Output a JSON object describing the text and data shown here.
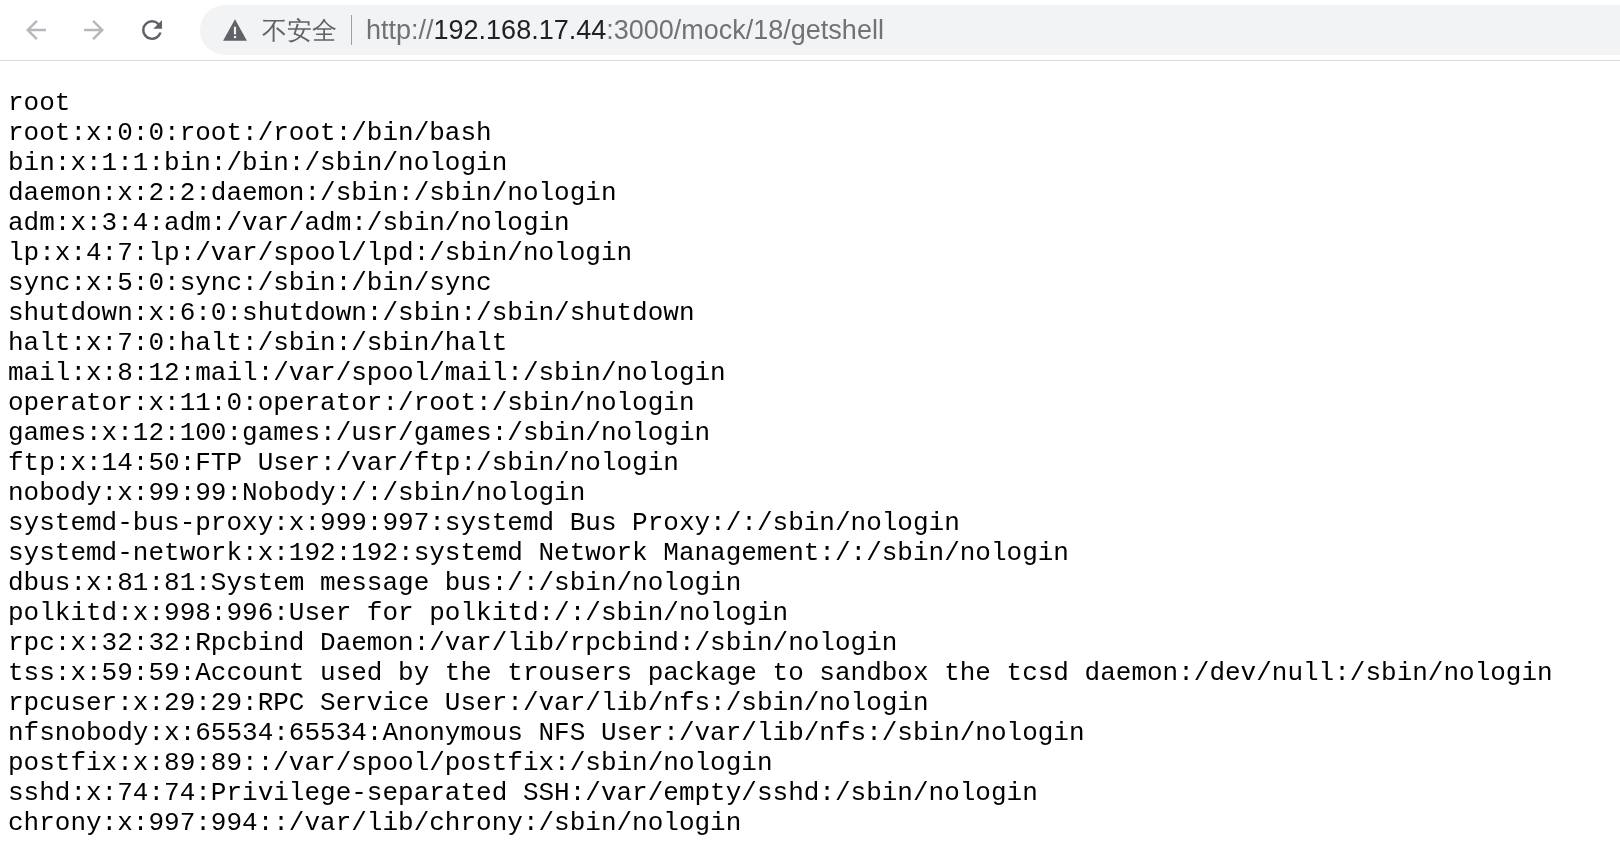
{
  "toolbar": {
    "back": {
      "disabled": true
    },
    "forward": {
      "disabled": true
    },
    "reload": {
      "disabled": false
    },
    "security_label": "不安全",
    "url": {
      "scheme": "http://",
      "host": "192.168.17.44",
      "path": ":3000/mock/18/getshell"
    }
  },
  "lines": [
    "root",
    "root:x:0:0:root:/root:/bin/bash",
    "bin:x:1:1:bin:/bin:/sbin/nologin",
    "daemon:x:2:2:daemon:/sbin:/sbin/nologin",
    "adm:x:3:4:adm:/var/adm:/sbin/nologin",
    "lp:x:4:7:lp:/var/spool/lpd:/sbin/nologin",
    "sync:x:5:0:sync:/sbin:/bin/sync",
    "shutdown:x:6:0:shutdown:/sbin:/sbin/shutdown",
    "halt:x:7:0:halt:/sbin:/sbin/halt",
    "mail:x:8:12:mail:/var/spool/mail:/sbin/nologin",
    "operator:x:11:0:operator:/root:/sbin/nologin",
    "games:x:12:100:games:/usr/games:/sbin/nologin",
    "ftp:x:14:50:FTP User:/var/ftp:/sbin/nologin",
    "nobody:x:99:99:Nobody:/:/sbin/nologin",
    "systemd-bus-proxy:x:999:997:systemd Bus Proxy:/:/sbin/nologin",
    "systemd-network:x:192:192:systemd Network Management:/:/sbin/nologin",
    "dbus:x:81:81:System message bus:/:/sbin/nologin",
    "polkitd:x:998:996:User for polkitd:/:/sbin/nologin",
    "rpc:x:32:32:Rpcbind Daemon:/var/lib/rpcbind:/sbin/nologin",
    "tss:x:59:59:Account used by the trousers package to sandbox the tcsd daemon:/dev/null:/sbin/nologin",
    "rpcuser:x:29:29:RPC Service User:/var/lib/nfs:/sbin/nologin",
    "nfsnobody:x:65534:65534:Anonymous NFS User:/var/lib/nfs:/sbin/nologin",
    "postfix:x:89:89::/var/spool/postfix:/sbin/nologin",
    "sshd:x:74:74:Privilege-separated SSH:/var/empty/sshd:/sbin/nologin",
    "chrony:x:997:994::/var/lib/chrony:/sbin/nologin"
  ]
}
